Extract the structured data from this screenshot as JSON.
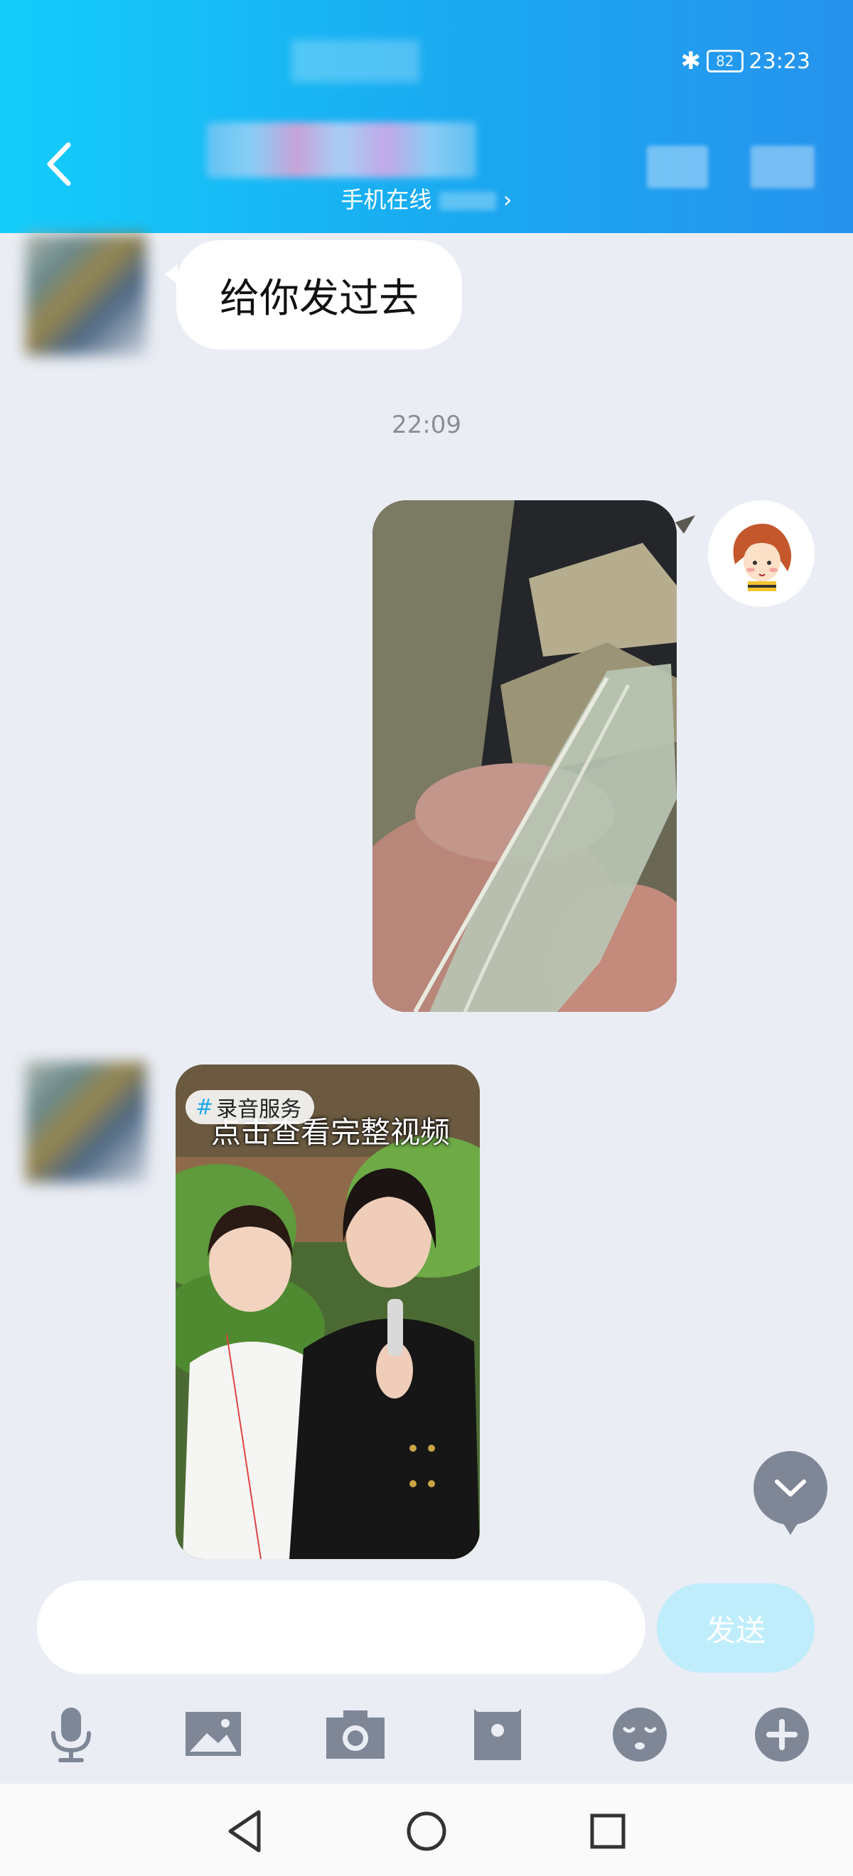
{
  "status_bar": {
    "battery": "82",
    "time": "23:23"
  },
  "header": {
    "online_status": "手机在线"
  },
  "messages": [
    {
      "type": "text",
      "direction": "incoming",
      "text": "给你发过去"
    },
    {
      "type": "timestamp",
      "text": "22:09"
    },
    {
      "type": "image",
      "direction": "outgoing"
    },
    {
      "type": "video",
      "direction": "incoming",
      "tag": "录音服务",
      "caption": "点击查看完整视频"
    }
  ],
  "input_bar": {
    "placeholder": "",
    "send_label": "发送"
  },
  "toolbar": [
    "microphone-icon",
    "image-icon",
    "camera-icon",
    "red-packet-icon",
    "emoji-icon",
    "plus-icon"
  ],
  "colors": {
    "header_start": "#14cdfb",
    "header_end": "#2693ee",
    "background": "#eaedf4",
    "send_button": "#bfedfb",
    "icon_gray": "#7f8797"
  }
}
